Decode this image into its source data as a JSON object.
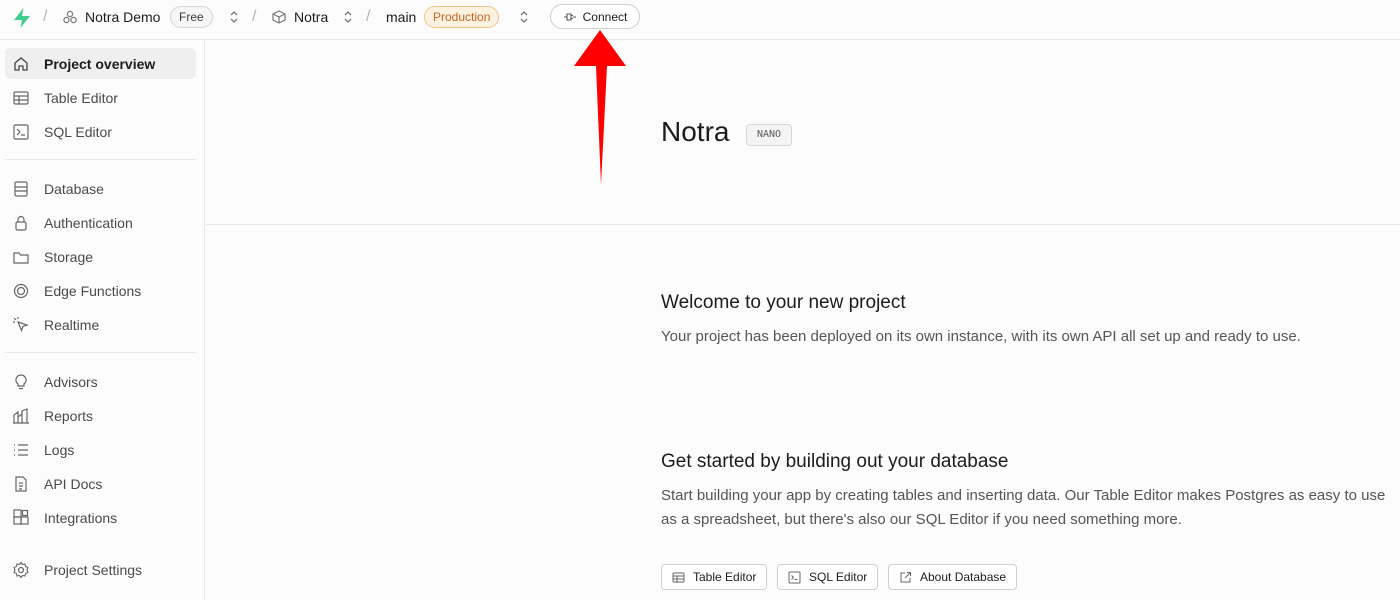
{
  "topbar": {
    "org_name": "Notra Demo",
    "org_plan": "Free",
    "project_name": "Notra",
    "branch_name": "main",
    "branch_env": "Production",
    "connect_label": "Connect"
  },
  "sidebar": {
    "items": [
      {
        "label": "Project overview",
        "icon": "home-icon",
        "active": true
      },
      {
        "label": "Table Editor",
        "icon": "table-icon"
      },
      {
        "label": "SQL Editor",
        "icon": "terminal-icon"
      },
      {
        "label": "Database",
        "icon": "database-icon"
      },
      {
        "label": "Authentication",
        "icon": "lock-icon"
      },
      {
        "label": "Storage",
        "icon": "archive-icon"
      },
      {
        "label": "Edge Functions",
        "icon": "functions-icon"
      },
      {
        "label": "Realtime",
        "icon": "cursor-click-icon"
      },
      {
        "label": "Advisors",
        "icon": "lightbulb-icon"
      },
      {
        "label": "Reports",
        "icon": "reports-icon"
      },
      {
        "label": "Logs",
        "icon": "list-icon"
      },
      {
        "label": "API Docs",
        "icon": "file-text-icon"
      },
      {
        "label": "Integrations",
        "icon": "blocks-icon"
      },
      {
        "label": "Project Settings",
        "icon": "gear-icon"
      }
    ]
  },
  "main": {
    "project_title": "Notra",
    "compute_badge": "NANO",
    "welcome": {
      "heading": "Welcome to your new project",
      "text": "Your project has been deployed on its own instance, with its own API all set up and ready to use."
    },
    "get_started": {
      "heading": "Get started by building out your database",
      "text": "Start building your app by creating tables and inserting data. Our Table Editor makes Postgres as easy to use as a spreadsheet, but there's also our SQL Editor if you need something more."
    },
    "buttons": {
      "table_editor": "Table Editor",
      "sql_editor": "SQL Editor",
      "about_database": "About Database"
    }
  },
  "colors": {
    "brand": "#3ecf8e",
    "production": "#c4671b",
    "annotation_arrow": "#ff0000"
  }
}
